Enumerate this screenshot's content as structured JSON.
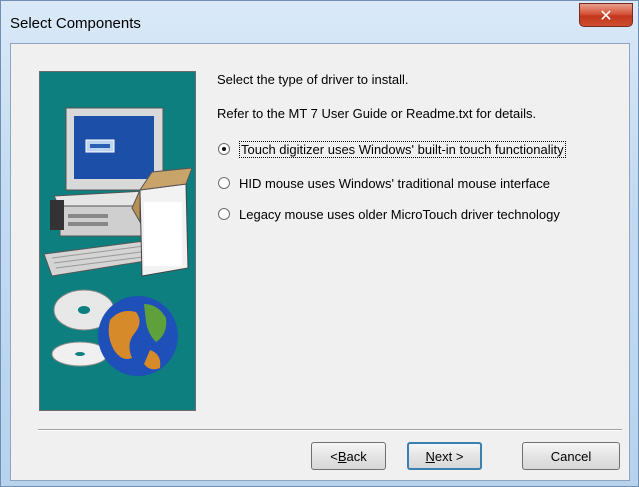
{
  "window": {
    "title": "Select Components",
    "close_label": "✕"
  },
  "main": {
    "prompt": "Select the type of driver to install.",
    "refer": "Refer to the MT 7 User Guide or Readme.txt for details.",
    "options": [
      {
        "label": "Touch digitizer uses Windows' built-in touch functionality",
        "selected": true
      },
      {
        "label": "HID mouse uses Windows' traditional mouse interface",
        "selected": false
      },
      {
        "label": "Legacy mouse uses older MicroTouch driver technology",
        "selected": false
      }
    ]
  },
  "buttons": {
    "back_prefix": "< ",
    "back_mnemonic": "B",
    "back_rest": "ack",
    "next_mnemonic": "N",
    "next_rest": "ext >",
    "cancel": "Cancel"
  },
  "colors": {
    "art_background": "#0e7f7f",
    "close_button": "#c2361d"
  },
  "icons": {
    "illustration": "computer-and-globe-illustration",
    "close": "close-icon"
  }
}
